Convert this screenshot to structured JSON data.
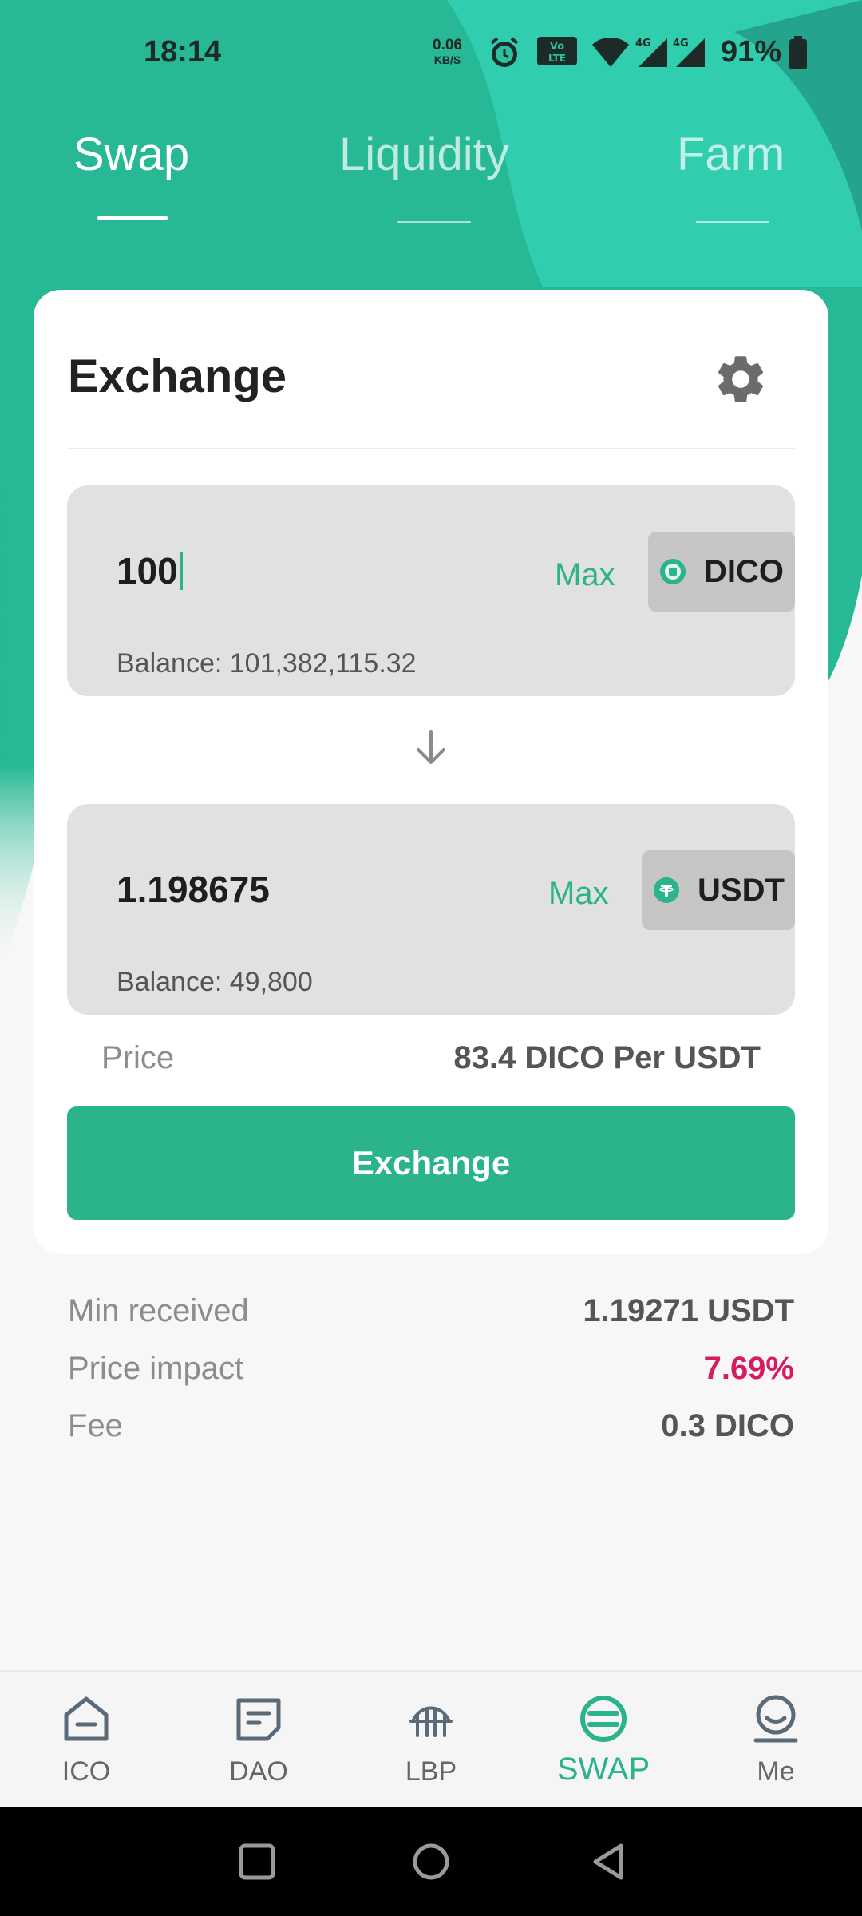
{
  "status_bar": {
    "time": "18:14",
    "net_speed_value": "0.06",
    "net_speed_unit": "KB/S",
    "battery": "91%",
    "icons": [
      "alarm-icon",
      "volte-icon",
      "wifi-icon",
      "signal-4g-icon",
      "signal-4g-icon",
      "battery-icon"
    ]
  },
  "top_tabs": [
    {
      "label": "Swap",
      "active": true
    },
    {
      "label": "Liquidity",
      "active": false
    },
    {
      "label": "Farm",
      "active": false
    }
  ],
  "card": {
    "title": "Exchange",
    "settings_icon": "gear-icon",
    "from": {
      "amount": "100",
      "max_label": "Max",
      "token": "DICO",
      "balance": "Balance: 101,382,115.32"
    },
    "to": {
      "amount": "1.198675",
      "max_label": "Max",
      "token": "USDT",
      "balance": "Balance: 49,800"
    },
    "price_label": "Price",
    "price_value": "83.4 DICO Per USDT",
    "exchange_button": "Exchange"
  },
  "details": {
    "min_received_label": "Min received",
    "min_received_value": "1.19271 USDT",
    "price_impact_label": "Price impact",
    "price_impact_value": "7.69%",
    "fee_label": "Fee",
    "fee_value": "0.3 DICO"
  },
  "bottom_nav": [
    {
      "label": "ICO",
      "icon": "home-icon",
      "active": false
    },
    {
      "label": "DAO",
      "icon": "dao-icon",
      "active": false
    },
    {
      "label": "LBP",
      "icon": "lbp-icon",
      "active": false
    },
    {
      "label": "SWAP",
      "icon": "swap-icon",
      "active": true
    },
    {
      "label": "Me",
      "icon": "profile-icon",
      "active": false
    }
  ],
  "colors": {
    "accent": "#2bb38b",
    "header_teal": "#2fc4a6",
    "impact_red": "#d81b60",
    "input_bg": "#e1e1e1"
  }
}
